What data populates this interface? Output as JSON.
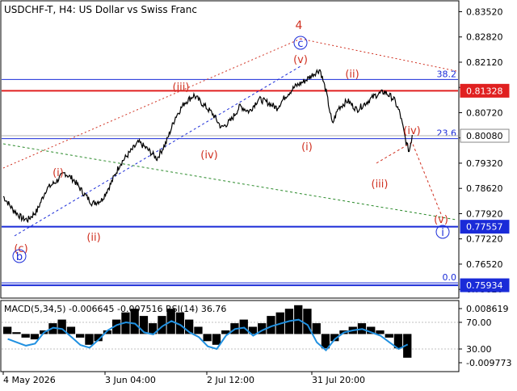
{
  "chart_data": {
    "type": "line",
    "title": "USDCHF-T, H4:  US Dollar vs Swiss Franc",
    "symbol": "USDCHF-T",
    "timeframe": "H4",
    "instrument": "US Dollar vs Swiss Franc",
    "price_axis": {
      "ylim": [
        0.756,
        0.838
      ],
      "ticks": [
        "0.83520",
        "0.82820",
        "0.82120",
        "0.81420",
        "0.80720",
        "0.80020",
        "0.79320",
        "0.78620",
        "0.77920",
        "0.77220",
        "0.76520",
        "0.75820"
      ]
    },
    "time_axis": {
      "labels": [
        "4 May 2026",
        "3 Jun 04:00",
        "2 Jul 12:00",
        "31 Jul 20:00"
      ]
    },
    "price_labels": [
      {
        "text": "0.81328",
        "value": 0.81328,
        "bg": "#e02020"
      },
      {
        "text": "0.80080",
        "value": 0.8008,
        "bg": "#ffffff"
      },
      {
        "text": "0.77557",
        "value": 0.77557,
        "bg": "#1a2bd8"
      },
      {
        "text": "0.75934",
        "value": 0.75934,
        "bg": "#1a2bd8"
      }
    ],
    "levels": [
      {
        "label": "",
        "value": 0.81328,
        "color": "#e02020",
        "kind": "support-resistance"
      },
      {
        "label": "",
        "value": 0.77557,
        "color": "#1a2bd8",
        "kind": "support-resistance"
      },
      {
        "label": "",
        "value": 0.75934,
        "color": "#1a2bd8",
        "kind": "support-resistance"
      },
      {
        "label": "38.2",
        "value": 0.8164,
        "color": "#1a2bd8",
        "kind": "fibonacci"
      },
      {
        "label": "23.6",
        "value": 0.8,
        "color": "#1a2bd8",
        "kind": "fibonacci"
      },
      {
        "label": "0.0",
        "value": 0.76,
        "color": "#1a2bd8",
        "kind": "fibonacci"
      }
    ],
    "price_series": [
      {
        "t": 0,
        "p": 0.784
      },
      {
        "t": 3,
        "p": 0.7805
      },
      {
        "t": 6,
        "p": 0.778
      },
      {
        "t": 8,
        "p": 0.7775
      },
      {
        "t": 11,
        "p": 0.78
      },
      {
        "t": 14,
        "p": 0.786
      },
      {
        "t": 17,
        "p": 0.788
      },
      {
        "t": 20,
        "p": 0.7905
      },
      {
        "t": 23,
        "p": 0.7885
      },
      {
        "t": 26,
        "p": 0.785
      },
      {
        "t": 29,
        "p": 0.782
      },
      {
        "t": 32,
        "p": 0.783
      },
      {
        "t": 35,
        "p": 0.7875
      },
      {
        "t": 38,
        "p": 0.793
      },
      {
        "t": 41,
        "p": 0.796
      },
      {
        "t": 44,
        "p": 0.799
      },
      {
        "t": 47,
        "p": 0.797
      },
      {
        "t": 50,
        "p": 0.7945
      },
      {
        "t": 53,
        "p": 0.799
      },
      {
        "t": 56,
        "p": 0.806
      },
      {
        "t": 59,
        "p": 0.81
      },
      {
        "t": 62,
        "p": 0.812
      },
      {
        "t": 65,
        "p": 0.8095
      },
      {
        "t": 68,
        "p": 0.807
      },
      {
        "t": 71,
        "p": 0.803
      },
      {
        "t": 74,
        "p": 0.805
      },
      {
        "t": 77,
        "p": 0.809
      },
      {
        "t": 80,
        "p": 0.8075
      },
      {
        "t": 83,
        "p": 0.811
      },
      {
        "t": 86,
        "p": 0.81
      },
      {
        "t": 89,
        "p": 0.8085
      },
      {
        "t": 92,
        "p": 0.812
      },
      {
        "t": 95,
        "p": 0.8145
      },
      {
        "t": 98,
        "p": 0.816
      },
      {
        "t": 101,
        "p": 0.818
      },
      {
        "t": 103,
        "p": 0.8192
      },
      {
        "t": 105,
        "p": 0.813
      },
      {
        "t": 107,
        "p": 0.804
      },
      {
        "t": 109,
        "p": 0.8085
      },
      {
        "t": 112,
        "p": 0.8105
      },
      {
        "t": 115,
        "p": 0.808
      },
      {
        "t": 118,
        "p": 0.81
      },
      {
        "t": 121,
        "p": 0.812
      },
      {
        "t": 124,
        "p": 0.813
      },
      {
        "t": 127,
        "p": 0.811
      },
      {
        "t": 129,
        "p": 0.807
      },
      {
        "t": 131,
        "p": 0.799
      },
      {
        "t": 132,
        "p": 0.7965
      },
      {
        "t": 133,
        "p": 0.801
      }
    ],
    "wave_labels": [
      {
        "text": "4",
        "color": "#d03020",
        "circled": false
      },
      {
        "text": "c",
        "color": "#1a2bd8",
        "circled": true
      },
      {
        "text": "(v)",
        "color": "#d03020",
        "circled": false
      },
      {
        "text": "(iii)",
        "color": "#d03020",
        "circled": false
      },
      {
        "text": "(ii)",
        "color": "#d03020",
        "circled": false
      },
      {
        "text": "(i)",
        "color": "#d03020",
        "circled": false
      },
      {
        "text": "(iv)",
        "color": "#d03020",
        "circled": false
      },
      {
        "text": "(i)",
        "color": "#d03020",
        "circled": false
      },
      {
        "text": "(ii)",
        "color": "#d03020",
        "circled": false
      },
      {
        "text": "(iv)",
        "color": "#d03020",
        "circled": false
      },
      {
        "text": "(iii)",
        "color": "#d03020",
        "circled": false
      },
      {
        "text": "(v)",
        "color": "#d03020",
        "circled": false
      },
      {
        "text": "i",
        "color": "#1a2bd8",
        "circled": true
      },
      {
        "text": "(c)",
        "color": "#d03020",
        "circled": false
      },
      {
        "text": "b",
        "color": "#1a2bd8",
        "circled": true
      }
    ],
    "indicator": {
      "label": "MACD(5,34,5) -0.006645 -0.007516 RSI(14) 36.76",
      "ticks": [
        "0.008619",
        "70.00",
        "30.00",
        "-0.009773"
      ],
      "macd_values": [
        0.002,
        0.0005,
        -0.001,
        -0.0015,
        0.001,
        0.003,
        0.004,
        0.002,
        -0.001,
        -0.003,
        -0.002,
        0.001,
        0.004,
        0.006,
        0.007,
        0.005,
        0.003,
        0.005,
        0.007,
        0.006,
        0.004,
        0.002,
        -0.002,
        -0.003,
        0.001,
        0.003,
        0.004,
        0.002,
        0.003,
        0.005,
        0.006,
        0.007,
        0.008,
        0.007,
        0.003,
        -0.004,
        -0.002,
        0.001,
        0.002,
        0.003,
        0.002,
        0.001,
        -0.001,
        -0.004,
        -0.0066
      ],
      "rsi_values": [
        45,
        40,
        35,
        38,
        55,
        62,
        60,
        48,
        36,
        32,
        44,
        58,
        66,
        70,
        68,
        55,
        52,
        64,
        72,
        66,
        55,
        48,
        34,
        30,
        50,
        60,
        62,
        50,
        58,
        64,
        68,
        72,
        74,
        66,
        40,
        28,
        45,
        55,
        58,
        60,
        55,
        50,
        40,
        30,
        36.76
      ]
    }
  }
}
